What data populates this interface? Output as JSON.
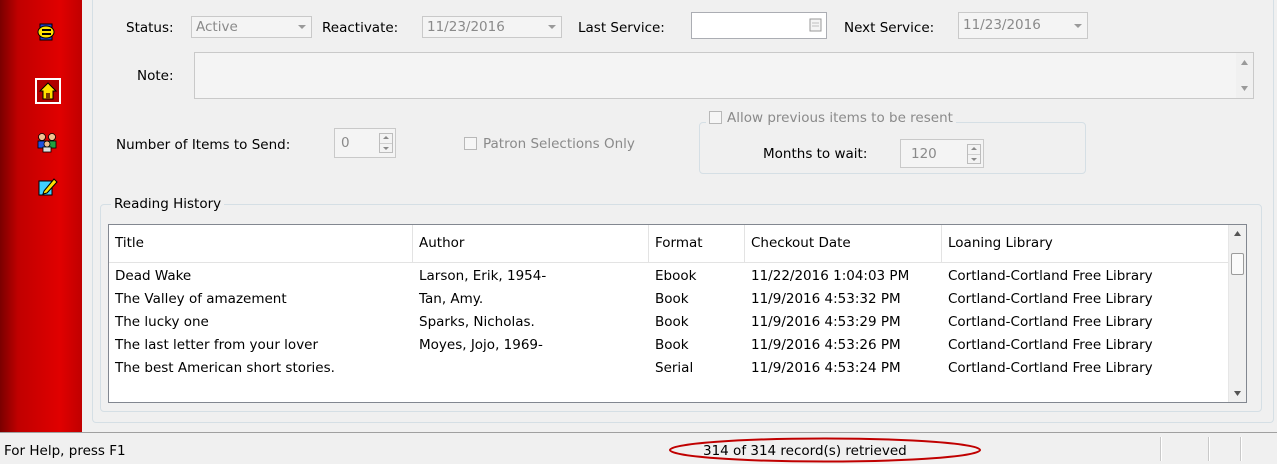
{
  "sidebar": {
    "icons": [
      "exit-door-icon",
      "home-icon",
      "people-group-icon",
      "edit-pencil-icon"
    ]
  },
  "form": {
    "status_label": "Status:",
    "status_value": "Active",
    "reactivate_label": "Reactivate:",
    "reactivate_value": "11/23/2016",
    "last_service_label": "Last Service:",
    "last_service_value": "",
    "next_service_label": "Next Service:",
    "next_service_value": "11/23/2016",
    "note_label": "Note:",
    "note_value": "",
    "items_to_send_label": "Number of Items to Send:",
    "items_to_send_value": "0",
    "patron_selections_label": "Patron Selections Only",
    "allow_resent_label": "Allow previous items to be resent",
    "months_to_wait_label": "Months to wait:",
    "months_to_wait_value": "120"
  },
  "reading_history": {
    "title": "Reading History",
    "columns": [
      "Title",
      "Author",
      "Format",
      "Checkout Date",
      "Loaning Library"
    ],
    "rows": [
      [
        "Dead Wake",
        "Larson, Erik, 1954-",
        "Ebook",
        "11/22/2016 1:04:03 PM",
        "Cortland-Cortland Free Library"
      ],
      [
        "The Valley of amazement",
        "Tan, Amy.",
        "Book",
        "11/9/2016 4:53:32 PM",
        "Cortland-Cortland Free Library"
      ],
      [
        "The lucky one",
        "Sparks, Nicholas.",
        "Book",
        "11/9/2016 4:53:29 PM",
        "Cortland-Cortland Free Library"
      ],
      [
        "The last letter from your lover",
        "Moyes, Jojo, 1969-",
        "Book",
        "11/9/2016 4:53:26 PM",
        "Cortland-Cortland Free Library"
      ],
      [
        "The best American short stories.",
        "",
        "Serial",
        "11/9/2016 4:53:24 PM",
        "Cortland-Cortland Free Library"
      ]
    ]
  },
  "statusbar": {
    "help_text": "For Help, press F1",
    "records_text": "314 of 314 record(s) retrieved"
  },
  "colors": {
    "sidebar_red": "#e00000",
    "highlight_ellipse": "#c00000"
  }
}
